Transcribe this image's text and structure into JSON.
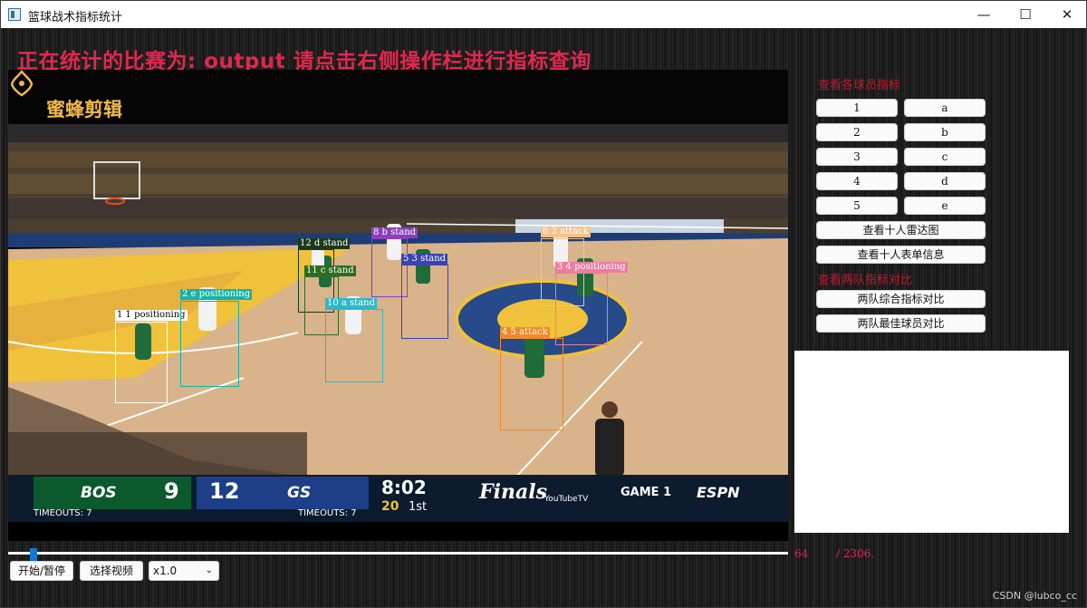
{
  "window": {
    "title": "篮球战术指标统计",
    "controls": {
      "minimize": "—",
      "maximize": "☐",
      "close": "✕"
    }
  },
  "headline": "正在统计的比赛为: output 请点击右侧操作栏进行指标查询",
  "video": {
    "brand": "蜜蜂剪辑",
    "detections": [
      {
        "label": "1 1 positioning",
        "color": "#ffffff",
        "text_color": "#000000"
      },
      {
        "label": "2 e positioning",
        "color": "#17b3a6",
        "text_color": "#ffffff"
      },
      {
        "label": "12 d stand",
        "color": "#1a3a1a",
        "text_color": "#ffffff"
      },
      {
        "label": "11 c stand",
        "color": "#2d6d1f",
        "text_color": "#ffffff"
      },
      {
        "label": "8 b stand",
        "color": "#8a3fbf",
        "text_color": "#ffffff"
      },
      {
        "label": "5 3 stand",
        "color": "#3a44b0",
        "text_color": "#ffffff"
      },
      {
        "label": "10 a stand",
        "color": "#2fb7c9",
        "text_color": "#ffffff"
      },
      {
        "label": "6 2 attack",
        "color": "#f4c48c",
        "text_color": "#ffffff"
      },
      {
        "label": "3 4 positioning",
        "color": "#f07aa0",
        "text_color": "#ffffff"
      },
      {
        "label": "4 5 attack",
        "color": "#f08a2b",
        "text_color": "#ffffff"
      }
    ],
    "scoreboard": {
      "team1": "BOS",
      "score1": "9",
      "team2": "GS",
      "score2": "12",
      "clock": "8:02",
      "shot_clock": "20",
      "period": "1st",
      "timeouts1": "TIMEOUTS: 7",
      "timeouts2": "TIMEOUTS: 7",
      "finals": "Finals",
      "sponsor": "YouTubeTV",
      "game": "GAME 1",
      "network": "ESPN"
    }
  },
  "playback": {
    "progress_fraction": 0.028,
    "current_frame": "64",
    "total_frames": "/ 2306.",
    "play_pause_label": "开始/暂停",
    "select_video_label": "选择视频",
    "speed_value": "x1.0"
  },
  "panel": {
    "section1_title": "查看各球员指标",
    "players_numbers": [
      "1",
      "2",
      "3",
      "4",
      "5"
    ],
    "players_letters": [
      "a",
      "b",
      "c",
      "d",
      "e"
    ],
    "radar_label": "查看十人雷达图",
    "table_label": "查看十人表单信息",
    "section2_title": "查看两队指标对比",
    "team_compare_label": "两队综合指标对比",
    "best_player_label": "两队最佳球员对比"
  },
  "watermark": "CSDN @lubco_cc"
}
